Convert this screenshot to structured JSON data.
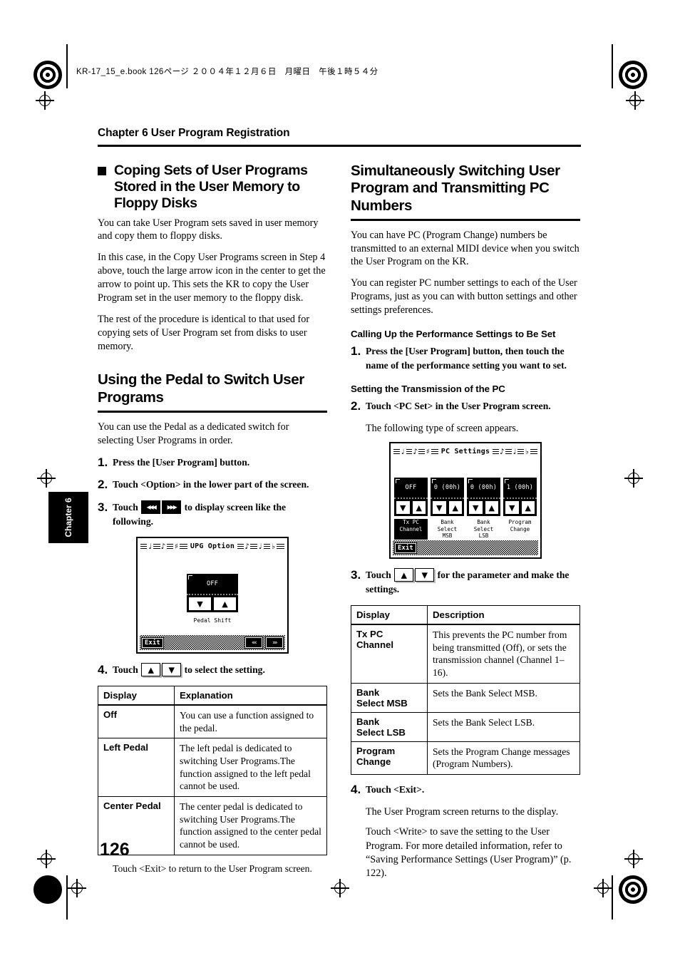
{
  "slug": "KR-17_15_e.book  126ページ  ２００４年１２月６日　月曜日　午後１時５４分",
  "chapter_header": "Chapter 6 User Program Registration",
  "side_tab": "Chapter 6",
  "page_number": "126",
  "left_column": {
    "section1": {
      "title": "Coping Sets of User Programs Stored in the User Memory to Floppy Disks",
      "paragraphs": [
        "You can take User Program sets saved in user memory and copy them to floppy disks.",
        "In this case, in the Copy User Programs screen in Step 4 above, touch the large arrow icon in the center to get the arrow to point up. This sets the KR to copy the User Program set in the user memory to the floppy disk.",
        "The rest of the procedure is identical to that used for copying sets of User Program set from disks to user memory."
      ]
    },
    "section2": {
      "title": "Using the Pedal to Switch User Programs",
      "intro": "You can use the Pedal as a dedicated switch for selecting User Programs in order.",
      "steps": [
        {
          "num": "1.",
          "text": "Press the [User Program] button."
        },
        {
          "num": "2.",
          "text": "Touch <Option> in the lower part of the screen."
        },
        {
          "num": "3.",
          "text_before": "Touch",
          "text_after": "to display screen like the following.",
          "icon1": "triple-left-chevron",
          "icon2": "triple-right-chevron"
        },
        {
          "num": "4.",
          "text_before": "Touch",
          "text_after": "to select the setting.",
          "icon1": "up-arrow",
          "icon2": "down-arrow"
        }
      ],
      "lcd": {
        "title": "UPG Option",
        "value": "OFF",
        "caption": "Pedal Shift",
        "btn_down": "▼",
        "btn_up": "▲",
        "exit_label": "Exit",
        "nav_prev": "«‹",
        "nav_next": "›»"
      },
      "table": {
        "headers": [
          "Display",
          "Explanation"
        ],
        "rows": [
          {
            "display": "Off",
            "explanation": "You can use a function assigned to the pedal."
          },
          {
            "display": "Left Pedal",
            "explanation": "The left pedal is dedicated to switching User Programs.The function assigned to the left pedal cannot be used."
          },
          {
            "display": "Center Pedal",
            "explanation": "The center pedal is dedicated to switching User Programs.The function assigned to the center pedal cannot be used."
          }
        ]
      },
      "note": "Touch <Exit> to return to the User Program screen."
    }
  },
  "right_column": {
    "section": {
      "title": "Simultaneously Switching User Program and Transmitting PC Numbers",
      "paragraphs": [
        "You can have PC (Program Change) numbers be transmitted to an external MIDI device when you switch the User Program on the KR.",
        "You can register PC number settings to each of the User Programs, just as you can with button settings and other settings preferences."
      ]
    },
    "subheading1": "Calling Up the Performance Settings to Be Set",
    "step1": {
      "num": "1.",
      "text": "Press the [User Program] button, then touch the name of the performance setting you want to set."
    },
    "subheading2": "Setting the Transmission of the PC",
    "step2": {
      "num": "2.",
      "text": "Touch <PC Set> in the User Program screen."
    },
    "step2_note": "The following type of screen appears.",
    "lcd": {
      "title": "PC Settings",
      "columns": [
        {
          "value": "OFF",
          "label": "Tx PC Channel",
          "highlighted": true
        },
        {
          "value": "0 (00h)",
          "label": "Bank Select\nMSB",
          "highlighted": false
        },
        {
          "value": "0 (00h)",
          "label": "Bank Select\nLSB",
          "highlighted": false
        },
        {
          "value": "1 (00h)",
          "label": "Program\nChange",
          "highlighted": false
        }
      ],
      "btn_down": "▼",
      "btn_up": "▲",
      "exit_label": "Exit"
    },
    "step3": {
      "num": "3.",
      "text_before": "Touch",
      "text_after": "for the parameter and make the settings.",
      "icon1": "up-arrow",
      "icon2": "down-arrow"
    },
    "table": {
      "headers": [
        "Display",
        "Description"
      ],
      "rows": [
        {
          "display": "Tx PC\nChannel",
          "description": "This prevents the PC number from being transmitted (Off), or sets the transmission channel (Channel 1–16)."
        },
        {
          "display": "Bank\nSelect MSB",
          "description": "Sets the Bank Select MSB."
        },
        {
          "display": "Bank\nSelect LSB",
          "description": "Sets the Bank Select LSB."
        },
        {
          "display": "Program\nChange",
          "description": "Sets the Program Change messages (Program Numbers)."
        }
      ]
    },
    "step4": {
      "num": "4.",
      "text": "Touch <Exit>."
    },
    "step4_notes": [
      "The User Program screen returns to the display.",
      "Touch <Write> to save the setting to the User Program. For more detailed information, refer to “Saving Performance Settings (User Program)” (p. 122)."
    ]
  }
}
